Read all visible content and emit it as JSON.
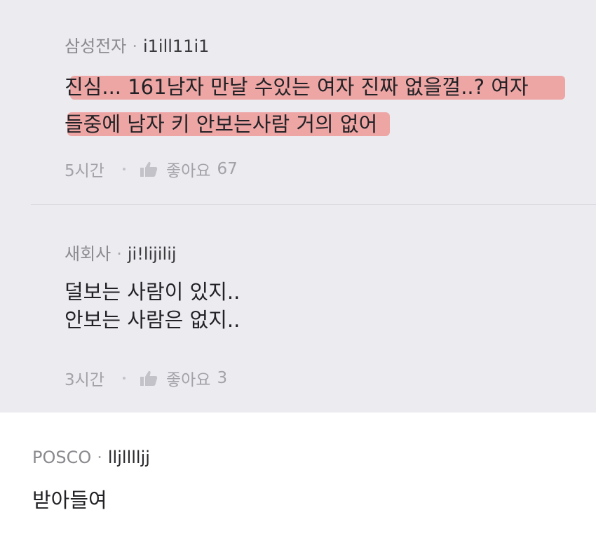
{
  "comments": [
    {
      "company": "삼성전자",
      "separator": "·",
      "user": "i1ill11i1",
      "lines": [
        "진심... 161남자 만날 수있는 여자 진짜 없을껄..? 여자",
        "들중에 남자 키 안보는사람 거의 없어"
      ],
      "time": "5시간",
      "like_label": "좋아요",
      "like_count": "67",
      "highlighted": true
    },
    {
      "company": "새회사",
      "separator": "·",
      "user": "ji!lijilij",
      "lines": [
        "덜보는 사람이 있지..",
        "안보는 사람은 없지.."
      ],
      "time": "3시간",
      "like_label": "좋아요",
      "like_count": "3",
      "highlighted": false
    },
    {
      "company": "POSCO",
      "separator": "·",
      "user": "lljlllljj",
      "lines": [
        "받아들여"
      ]
    }
  ],
  "colors": {
    "reply_background": "#ebebf0",
    "highlight": "#ee9a98",
    "main_background": "#ffffff"
  },
  "icons": {
    "like": "thumbs-up-icon"
  }
}
